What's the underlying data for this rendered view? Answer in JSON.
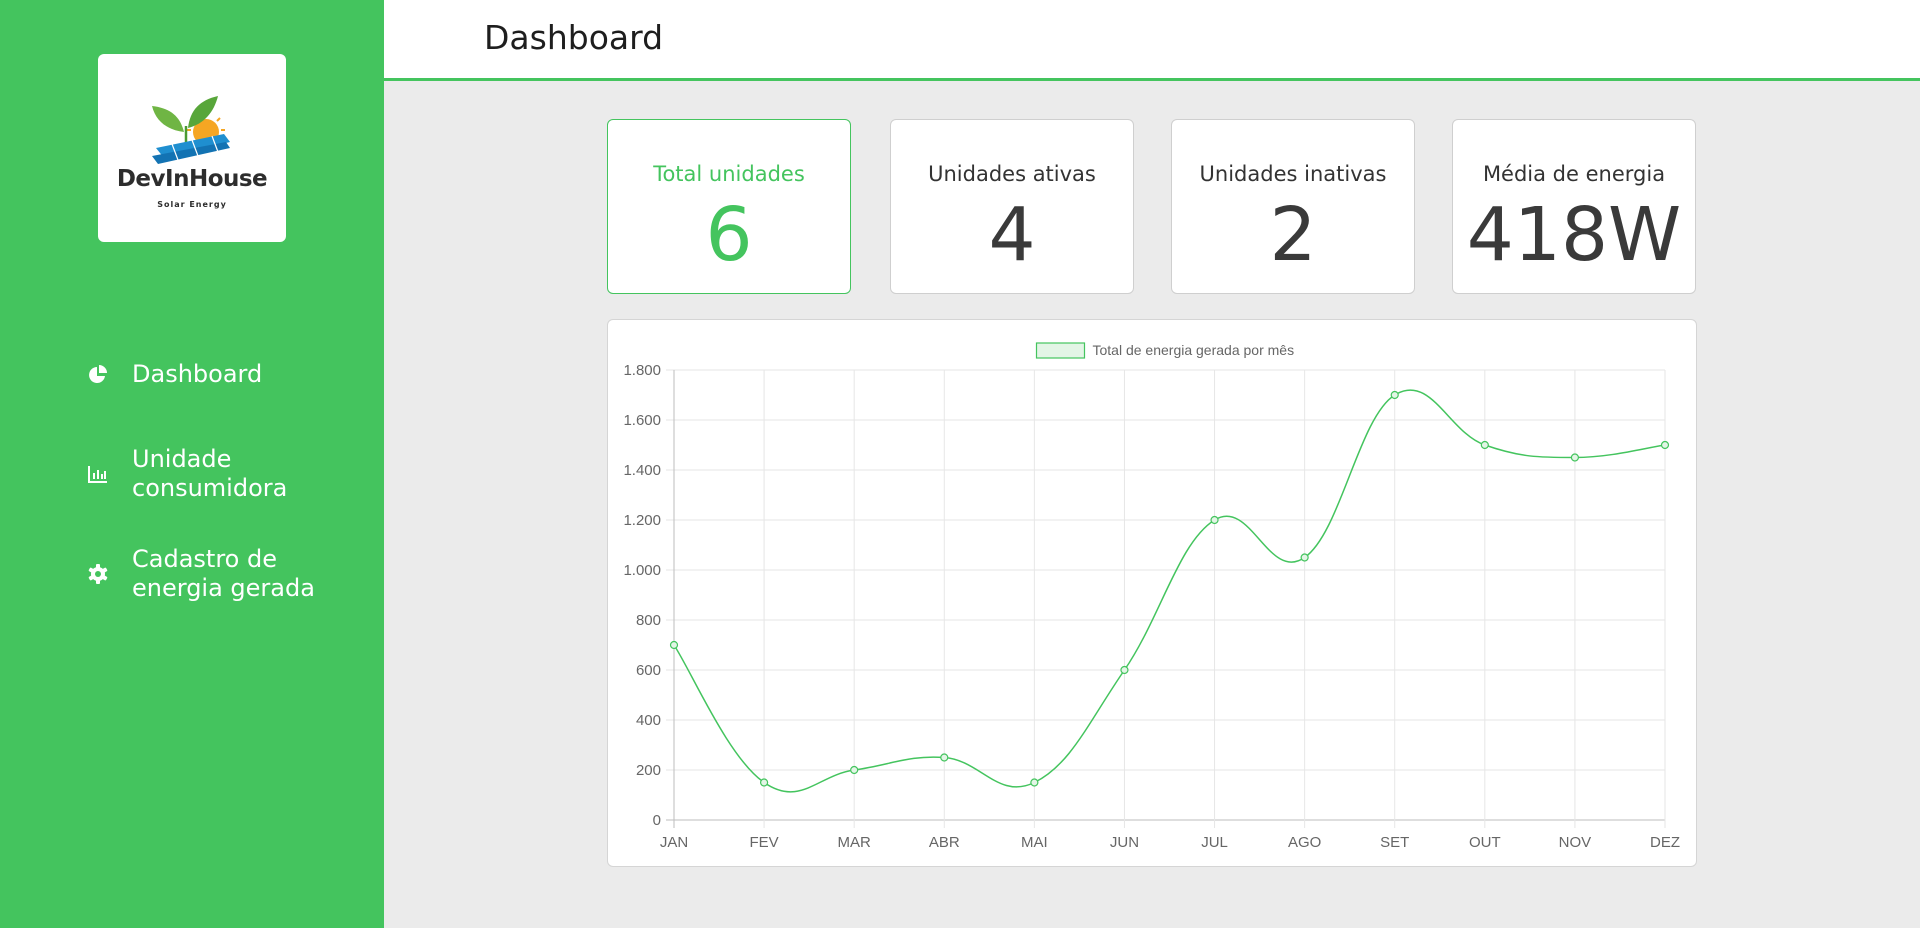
{
  "brand": {
    "name": "DevInHouse",
    "tagline": "Solar Energy",
    "accent_color": "#44c45e"
  },
  "sidebar": {
    "items": [
      {
        "label": "Dashboard",
        "icon": "pie-chart-icon"
      },
      {
        "label": "Unidade consumidora",
        "icon": "bar-chart-icon"
      },
      {
        "label": "Cadastro de energia gerada",
        "icon": "gear-icon"
      }
    ]
  },
  "header": {
    "title": "Dashboard"
  },
  "cards": [
    {
      "label": "Total unidades",
      "value": "6"
    },
    {
      "label": "Unidades ativas",
      "value": "4"
    },
    {
      "label": "Unidades inativas",
      "value": "2"
    },
    {
      "label": "Média de energia",
      "value": "418W"
    }
  ],
  "chart_data": {
    "type": "line",
    "title": "",
    "xlabel": "",
    "ylabel": "",
    "categories": [
      "JAN",
      "FEV",
      "MAR",
      "ABR",
      "MAI",
      "JUN",
      "JUL",
      "AGO",
      "SET",
      "OUT",
      "NOV",
      "DEZ"
    ],
    "series": [
      {
        "name": "Total de energia gerada por mês",
        "color": "#44c45e",
        "values": [
          700,
          150,
          200,
          250,
          150,
          600,
          1200,
          1050,
          1700,
          1500,
          1450,
          1500
        ]
      }
    ],
    "ylim": [
      0,
      1800
    ],
    "yticks": [
      "0",
      "200",
      "400",
      "600",
      "800",
      "1.000",
      "1.200",
      "1.400",
      "1.600",
      "1.800"
    ],
    "grid": true,
    "legend": "top"
  }
}
